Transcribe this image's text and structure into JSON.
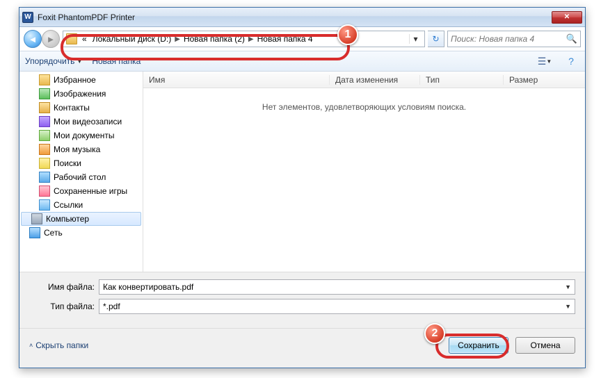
{
  "window": {
    "title": "Foxit PhantomPDF Printer",
    "icon_letter": "W"
  },
  "address": {
    "prefix": "«",
    "crumbs": [
      "Локальный диск (D:)",
      "Новая папка (2)",
      "Новая папка 4"
    ]
  },
  "search": {
    "placeholder": "Поиск: Новая папка 4"
  },
  "toolbar": {
    "organize": "Упорядочить",
    "new_folder": "Новая папка"
  },
  "tree": {
    "items": [
      {
        "label": "Избранное",
        "icon": "ic-fav"
      },
      {
        "label": "Изображения",
        "icon": "ic-img"
      },
      {
        "label": "Контакты",
        "icon": "ic-contacts"
      },
      {
        "label": "Мои видеозаписи",
        "icon": "ic-video"
      },
      {
        "label": "Мои документы",
        "icon": "ic-docs"
      },
      {
        "label": "Моя музыка",
        "icon": "ic-music"
      },
      {
        "label": "Поиски",
        "icon": "ic-search"
      },
      {
        "label": "Рабочий стол",
        "icon": "ic-desktop"
      },
      {
        "label": "Сохраненные игры",
        "icon": "ic-saved"
      },
      {
        "label": "Ссылки",
        "icon": "ic-links"
      }
    ],
    "computer": "Компьютер",
    "network": "Сеть"
  },
  "list": {
    "columns": {
      "name": "Имя",
      "date": "Дата изменения",
      "type": "Тип",
      "size": "Размер"
    },
    "empty_text": "Нет элементов, удовлетворяющих условиям поиска."
  },
  "form": {
    "filename_label": "Имя файла:",
    "filename_value": "Как конвертировать.pdf",
    "filetype_label": "Тип файла:",
    "filetype_value": "*.pdf"
  },
  "footer": {
    "hide_folders": "Скрыть папки",
    "save": "Сохранить",
    "cancel": "Отмена"
  },
  "annotations": {
    "one": "1",
    "two": "2"
  }
}
